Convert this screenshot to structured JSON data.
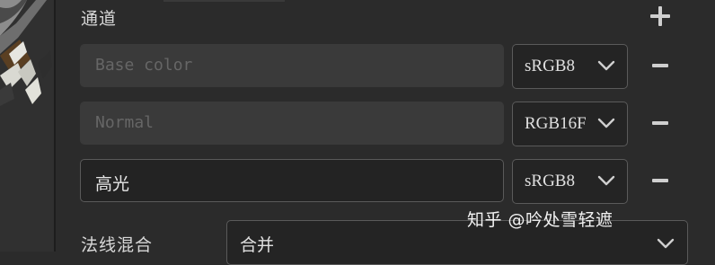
{
  "channels": {
    "title": "通道",
    "add_icon": "plus-icon",
    "rows": [
      {
        "name": "",
        "placeholder": "Base color",
        "format": "sRGB8",
        "chevron_icon": "chevron-down-icon",
        "remove_icon": "minus-icon"
      },
      {
        "name": "",
        "placeholder": "Normal",
        "format": "RGB16F",
        "chevron_icon": "chevron-down-icon",
        "remove_icon": "minus-icon"
      },
      {
        "name": "高光",
        "placeholder": "",
        "format": "sRGB8",
        "chevron_icon": "chevron-down-icon",
        "remove_icon": "minus-icon"
      }
    ]
  },
  "normal_blend": {
    "label": "法线混合",
    "value": "合并",
    "chevron_icon": "chevron-down-icon"
  },
  "watermark": "知乎 @吟处雪轻遮",
  "colors": {
    "background": "#2b2b2b",
    "field_disabled": "#3a3a3a",
    "field_active": "#232323",
    "border": "#5a5a5a",
    "icon": "#cfcfcf"
  }
}
